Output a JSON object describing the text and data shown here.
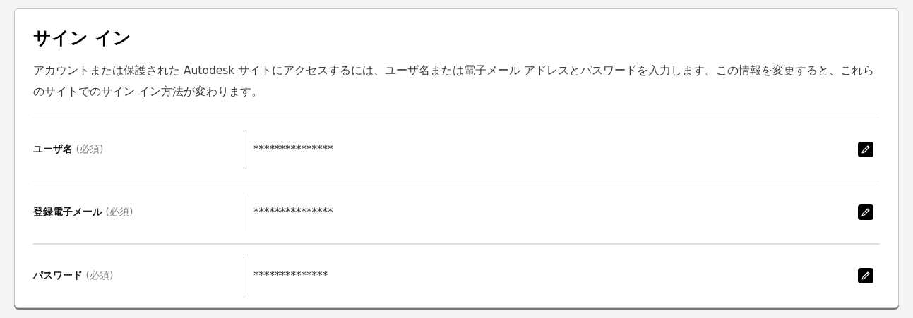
{
  "title": "サイン イン",
  "description": "アカウントまたは保護された Autodesk サイトにアクセスするには、ユーザ名または電子メール アドレスとパスワードを入力します。この情報を変更すると、これらのサイトでのサイン イン方法が変わります。",
  "fields": [
    {
      "label": "ユーザ名",
      "required_note": "(必須)",
      "value": "***************"
    },
    {
      "label": "登録電子メール",
      "required_note": "(必須)",
      "value": "***************"
    },
    {
      "label": "パスワード",
      "required_note": "(必須)",
      "value": "**************"
    }
  ]
}
